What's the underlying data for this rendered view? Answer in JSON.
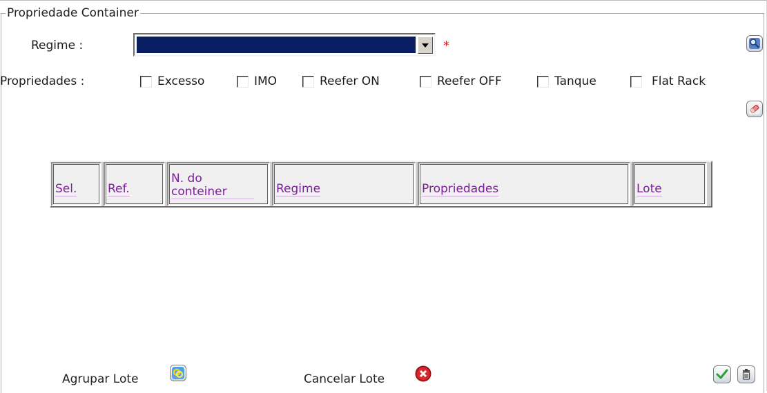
{
  "group": {
    "title": "Propriedade Container"
  },
  "regime": {
    "label": "Regime :",
    "value": "",
    "required_mark": "*"
  },
  "propriedades": {
    "label": "Propriedades :",
    "options": [
      {
        "label": "Excesso",
        "checked": false
      },
      {
        "label": "IMO",
        "checked": false
      },
      {
        "label": "Reefer ON",
        "checked": false
      },
      {
        "label": "Reefer OFF",
        "checked": false
      },
      {
        "label": "Tanque",
        "checked": false
      },
      {
        "label": "Flat Rack",
        "checked": false
      }
    ]
  },
  "table": {
    "columns": [
      "Sel.",
      "Ref.",
      "N. do conteiner",
      "Regime",
      "Propriedades",
      "Lote"
    ],
    "rows": []
  },
  "actions": {
    "agrupar_lote": "Agrupar Lote",
    "cancelar_lote": "Cancelar Lote"
  },
  "colors": {
    "select_fill": "#0a1f63",
    "header_link": "#7e1f9a",
    "required": "#e0242a"
  },
  "icons": [
    "search-icon",
    "eraser-icon",
    "group-lot-icon",
    "cancel-lot-icon",
    "confirm-icon",
    "trash-icon"
  ]
}
